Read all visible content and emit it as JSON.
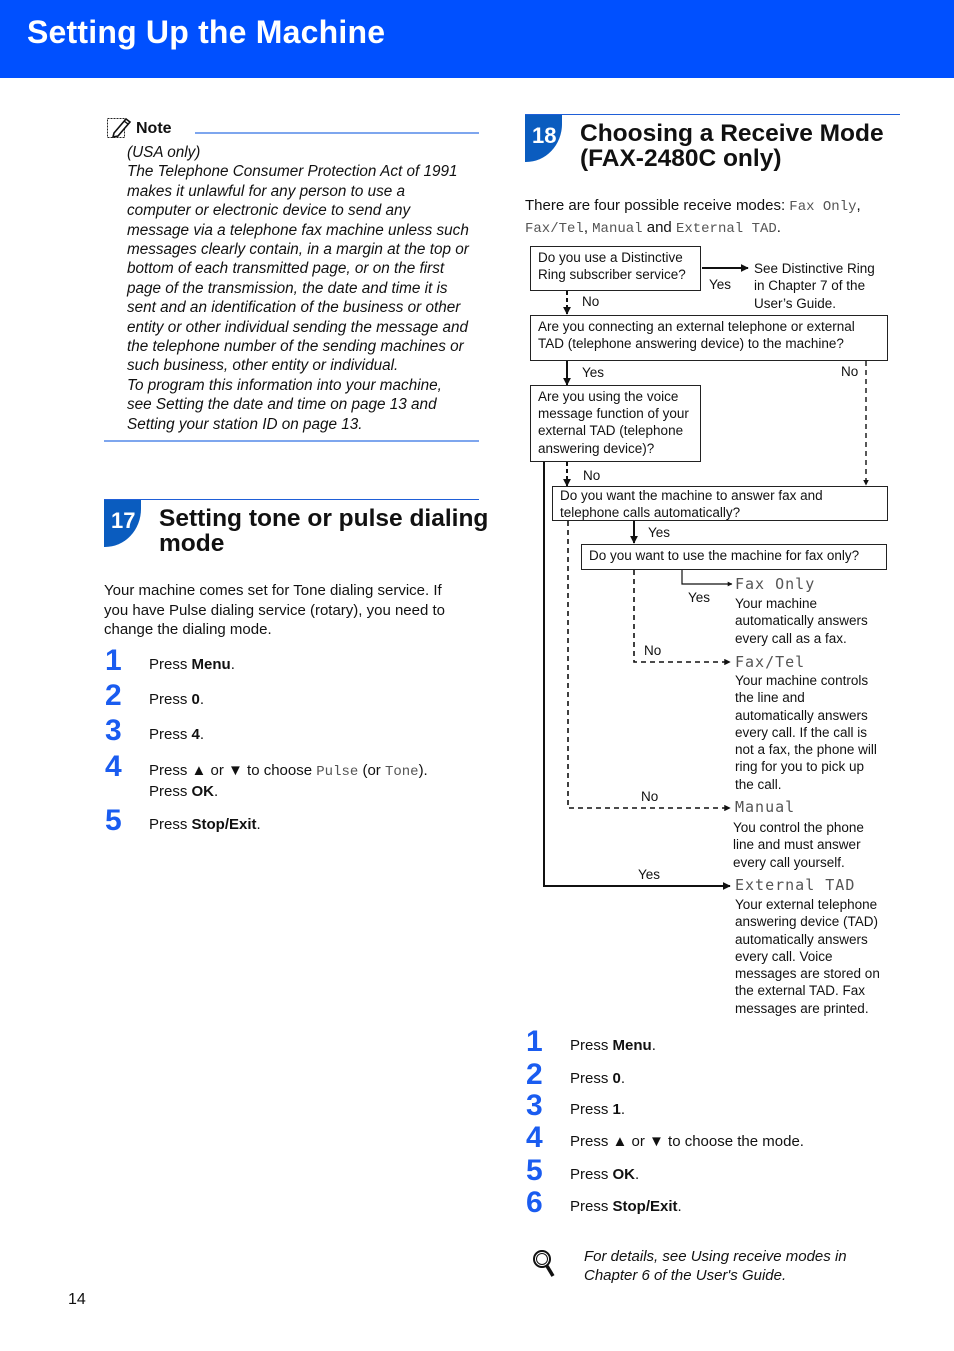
{
  "header": {
    "title": "Setting Up the Machine",
    "color": "#0050ff"
  },
  "note": {
    "label": "Note",
    "icon": "note-pencil-icon",
    "lines": [
      "(USA only)",
      "The Telephone Consumer Protection Act of 1991",
      "makes it unlawful for any person to use a",
      "computer or electronic device to send any",
      "message via a telephone fax machine unless such",
      "messages clearly contain, in a margin at the top or",
      "bottom of each transmitted page, or on the first",
      "page of the transmission, the date and time it is",
      "sent and an identification of the business or other",
      "entity or other individual sending the message and",
      "the telephone number of the sending machines or",
      "such business, other entity or individual.",
      "To program this information into your machine,",
      "see Setting the date and time on page 13 and",
      "Setting your station ID on page 13."
    ]
  },
  "section17": {
    "number": "17",
    "title_line1": "Setting tone or pulse dialing",
    "title_line2": "mode",
    "intro_lines": [
      "Your machine comes set for Tone dialing service. If",
      "you have Pulse dialing service (rotary), you need to",
      "change the dialing mode."
    ],
    "steps": [
      {
        "num": "1",
        "prefix": "Press ",
        "bold": "Menu",
        "suffix": "."
      },
      {
        "num": "2",
        "prefix": "Press ",
        "bold": "0",
        "suffix": "."
      },
      {
        "num": "3",
        "prefix": "Press ",
        "bold": "4",
        "suffix": "."
      },
      {
        "num": "4",
        "prefix": "Press ▲ or ▼ to choose ",
        "mono1": "Pulse",
        "mid": " (or ",
        "mono2": "Tone",
        "end": ").",
        "line2_prefix": "Press ",
        "line2_bold": "OK",
        "line2_suffix": "."
      },
      {
        "num": "5",
        "prefix": "Press ",
        "bold": "Stop/Exit",
        "suffix": "."
      }
    ]
  },
  "section18": {
    "number": "18",
    "title_line1": "Choosing a Receive Mode",
    "title_line2": "(FAX-2480C only)",
    "intro_prefix": "There are four possible receive modes: ",
    "modes_inline": [
      "Fax Only",
      "Fax/Tel",
      "Manual",
      "External TAD"
    ],
    "intro_sep1": ",",
    "intro_sep2": ", ",
    "intro_and": " and ",
    "intro_end": ".",
    "flowchart": {
      "q1_lines": [
        "Do you use a Distinctive",
        "Ring subscriber service?"
      ],
      "q1_yes": "Yes",
      "q1_yes_result": [
        "See Distinctive Ring",
        "in Chapter 7 of the",
        "User’s Guide."
      ],
      "q1_no": "No",
      "q2_lines": [
        "Are you connecting an external telephone or external",
        "TAD (telephone answering device) to the machine?"
      ],
      "q2_yes": "Yes",
      "q2_no": "No",
      "q3_lines": [
        "Are you using the voice",
        "message function of your",
        "external TAD (telephone",
        "answering device)?"
      ],
      "q3_no": "No",
      "q3_yes": "Yes",
      "q4_lines": [
        "Do you want the machine to answer fax and",
        "telephone calls automatically?"
      ],
      "q4_yes": "Yes",
      "q4_no": "No",
      "q5_text": "Do you want to use the machine for fax only?",
      "q5_yes": "Yes",
      "q5_no": "No",
      "results": [
        {
          "mode": "Fax Only",
          "desc": [
            "Your machine",
            "automatically answers",
            "every call as a fax."
          ]
        },
        {
          "mode": "Fax/Tel",
          "desc": [
            "Your machine controls",
            "the line and",
            "automatically answers",
            "every call. If the call is",
            "not a fax, the phone will",
            "ring for you to pick up",
            "the call."
          ]
        },
        {
          "mode": "Manual",
          "desc": [
            "You control the phone",
            "line and must answer",
            "every call yourself."
          ]
        },
        {
          "mode": "External TAD",
          "desc": [
            "Your external telephone",
            "answering device (TAD)",
            "automatically answers",
            "every call. Voice",
            "messages are stored on",
            "the external TAD. Fax",
            "messages are printed."
          ]
        }
      ]
    },
    "steps": [
      {
        "num": "1",
        "prefix": "Press ",
        "bold": "Menu",
        "suffix": "."
      },
      {
        "num": "2",
        "prefix": "Press ",
        "bold": "0",
        "suffix": "."
      },
      {
        "num": "3",
        "prefix": "Press ",
        "bold": "1",
        "suffix": "."
      },
      {
        "num": "4",
        "prefix": "Press ▲ or ▼ to choose the mode.",
        "bold": "",
        "suffix": ""
      },
      {
        "num": "5",
        "prefix": "Press ",
        "bold": "OK",
        "suffix": "."
      },
      {
        "num": "6",
        "prefix": "Press ",
        "bold": "Stop/Exit",
        "suffix": "."
      }
    ],
    "tip": {
      "icon": "magnifier-icon",
      "lines": [
        "For details, see Using receive modes in",
        "Chapter 6 of the User's Guide."
      ]
    }
  },
  "footer": {
    "page_number": "14"
  },
  "colors": {
    "accent": "#0050ff",
    "badge": "#0a5cbf",
    "step_number": "#1a5cf0",
    "rule": "#7ea6ee"
  }
}
